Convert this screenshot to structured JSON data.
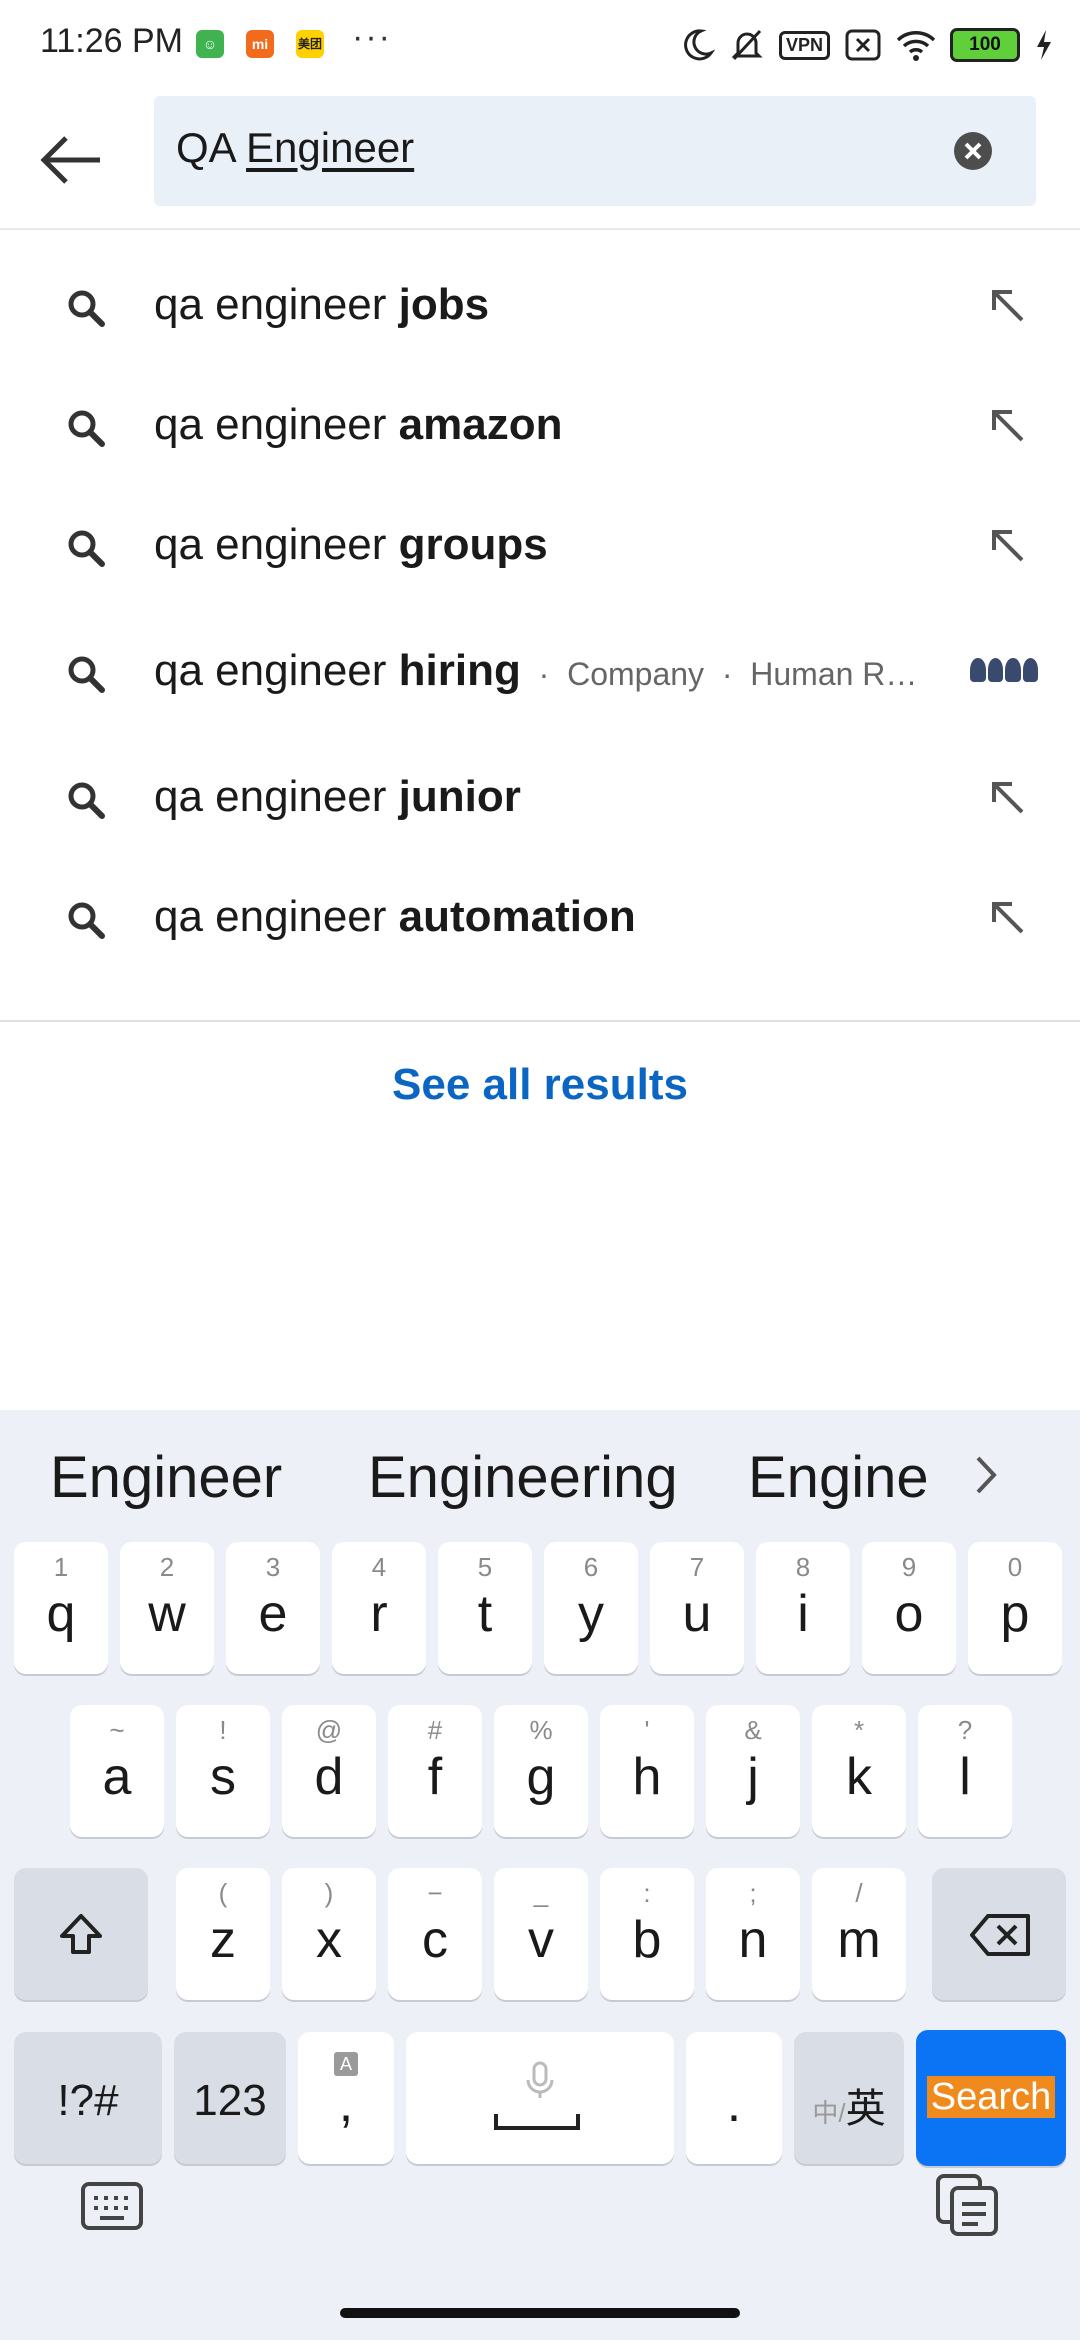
{
  "status_bar": {
    "time": "11:26 PM",
    "app_icons": [
      "wechat-icon",
      "mi-icon",
      "meituan-icon"
    ],
    "app_icon_labels": [
      "",
      "mi",
      "美团"
    ],
    "overflow": "···",
    "vpn_label": "VPN",
    "battery": "100"
  },
  "search": {
    "query_plain": "QA ",
    "query_composing": "Engineer"
  },
  "suggestions": [
    {
      "prefix": "qa engineer ",
      "bold": "jobs"
    },
    {
      "prefix": "qa engineer ",
      "bold": "amazon"
    },
    {
      "prefix": "qa engineer ",
      "bold": "groups"
    },
    {
      "prefix": "qa engineer ",
      "bold": "hiring",
      "meta1": "Company",
      "meta2": "Human R…"
    },
    {
      "prefix": "qa engineer ",
      "bold": "junior"
    },
    {
      "prefix": "qa engineer ",
      "bold": "automation"
    }
  ],
  "see_all": "See all results",
  "keyboard": {
    "predictions": [
      "Engineer",
      "Engineering",
      "Engine"
    ],
    "row1": [
      {
        "k": "q",
        "s": "1"
      },
      {
        "k": "w",
        "s": "2"
      },
      {
        "k": "e",
        "s": "3"
      },
      {
        "k": "r",
        "s": "4"
      },
      {
        "k": "t",
        "s": "5"
      },
      {
        "k": "y",
        "s": "6"
      },
      {
        "k": "u",
        "s": "7"
      },
      {
        "k": "i",
        "s": "8"
      },
      {
        "k": "o",
        "s": "9"
      },
      {
        "k": "p",
        "s": "0"
      }
    ],
    "row2": [
      {
        "k": "a",
        "s": "~"
      },
      {
        "k": "s",
        "s": "!"
      },
      {
        "k": "d",
        "s": "@"
      },
      {
        "k": "f",
        "s": "#"
      },
      {
        "k": "g",
        "s": "%"
      },
      {
        "k": "h",
        "s": "'"
      },
      {
        "k": "j",
        "s": "&"
      },
      {
        "k": "k",
        "s": "*"
      },
      {
        "k": "l",
        "s": "?"
      }
    ],
    "row3": [
      {
        "k": "z",
        "s": "("
      },
      {
        "k": "x",
        "s": ")"
      },
      {
        "k": "c",
        "s": "−"
      },
      {
        "k": "v",
        "s": "_"
      },
      {
        "k": "b",
        "s": ":"
      },
      {
        "k": "n",
        "s": ";"
      },
      {
        "k": "m",
        "s": "/"
      }
    ],
    "symbols_label": "!?#",
    "numbers_label": "123",
    "comma_label": ",",
    "period_label": ".",
    "lang_label_small": "中/",
    "lang_label": "英",
    "search_label": "Search"
  }
}
